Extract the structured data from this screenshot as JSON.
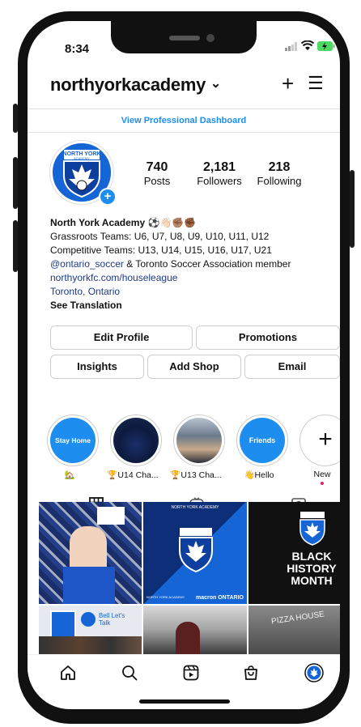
{
  "status": {
    "time": "8:34"
  },
  "header": {
    "username": "northyorkacademy",
    "chevron": "⌄",
    "plus": "+",
    "menu": "☰"
  },
  "dashboard_label": "View Professional Dashboard",
  "avatar_text": {
    "line1": "NORTH YORK",
    "line2": "ACADEMY"
  },
  "stats": [
    {
      "value": "740",
      "label": "Posts"
    },
    {
      "value": "2,181",
      "label": "Followers"
    },
    {
      "value": "218",
      "label": "Following"
    }
  ],
  "bio": {
    "name": "North York Academy",
    "name_emojis": "⚽👋🏻✊🏽✊🏾",
    "line1": "Grassroots Teams: U6, U7, U8, U9, U10, U11, U12",
    "line2": "Competitive Teams: U13, U14, U15, U16, U17, U21",
    "mention": "@ontario_soccer",
    "line3_rest": " & Toronto Soccer Association member",
    "website": "northyorkfc.com/houseleague",
    "location": "Toronto, Ontario",
    "translate": "See Translation"
  },
  "buttons": {
    "edit_profile": "Edit Profile",
    "promotions": "Promotions",
    "insights": "Insights",
    "add_shop": "Add Shop",
    "email": "Email"
  },
  "highlights": [
    {
      "cover_text": "Stay Home",
      "label": "🏡"
    },
    {
      "cover_text": "",
      "label": "🏆U14 Cha..."
    },
    {
      "cover_text": "",
      "label": "🏆U13 Cha..."
    },
    {
      "cover_text": "Friends",
      "label": "👋Hello"
    },
    {
      "cover_text": "+",
      "label": "New"
    }
  ],
  "posts": {
    "post2_top": "NORTH YORK ACADEMY",
    "post2_bottom_left": "NORTH YORK ACADEMY",
    "post2_bottom_right": "macron ONTARIO",
    "post3_text": "BLACK HISTORY MONTH",
    "post4_text": "Bell Let's Talk",
    "post6_text": "PIZZA HOUSE"
  },
  "colors": {
    "brand_blue": "#1565d6",
    "link_blue": "#1d8ef0",
    "dark_link": "#1e3a8a"
  }
}
